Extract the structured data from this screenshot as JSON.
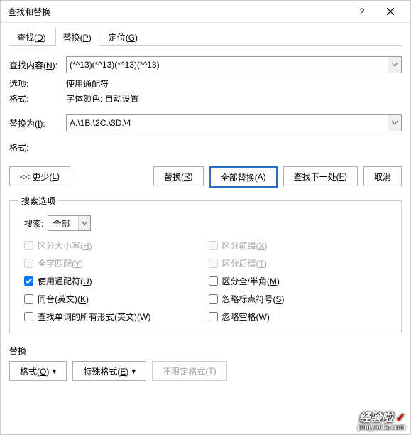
{
  "title": "查找和替换",
  "tabs": {
    "find": "查找(<u>D</u>)",
    "replace": "替换(<u>P</u>)",
    "goto": "定位(<u>G</u>)"
  },
  "labels": {
    "find_what": "查找内容(<u>N</u>):",
    "options": "选项:",
    "format": "格式:",
    "replace_with": "替换为(<u>I</u>):",
    "format2": "格式:"
  },
  "values": {
    "find_what": "(*^13)(*^13)(*^13)(*^13)",
    "options": "使用通配符",
    "format": "字体颜色: 自动设置",
    "replace_with": "A.\\1B.\\2C.\\3D.\\4"
  },
  "buttons": {
    "less": "<< 更少(<u>L</u>)",
    "replace": "替换(<u>R</u>)",
    "replace_all": "全部替换(<u>A</u>)",
    "find_next": "查找下一处(<u>F</u>)",
    "cancel": "取消"
  },
  "search_options": {
    "legend": "搜索选项",
    "search_label": "搜索:",
    "scope": "全部",
    "match_case": "区分大小写(<u>H</u>)",
    "whole_word": "全字匹配(<u>Y</u>)",
    "use_wildcards": "使用通配符(<u>U</u>)",
    "sounds_like": "同音(英文)(<u>K</u>)",
    "all_word_forms": "查找单词的所有形式(英文)(<u>W</u>)",
    "match_prefix": "区分前缀(<u>X</u>)",
    "match_suffix": "区分后缀(<u>T</u>)",
    "half_full": "区分全/半角(<u>M</u>)",
    "ignore_punct": "忽略标点符号(<u>S</u>)",
    "ignore_space": "忽略空格(<u>W</u>)"
  },
  "bottom": {
    "section": "替换",
    "format_btn": "格式(<u>O</u>)",
    "special_btn": "特殊格式(<u>E</u>)",
    "no_format_btn": "不限定格式(<u>T</u>)"
  },
  "watermark": {
    "main": "经验啦",
    "sub": "jingyanla.com"
  }
}
